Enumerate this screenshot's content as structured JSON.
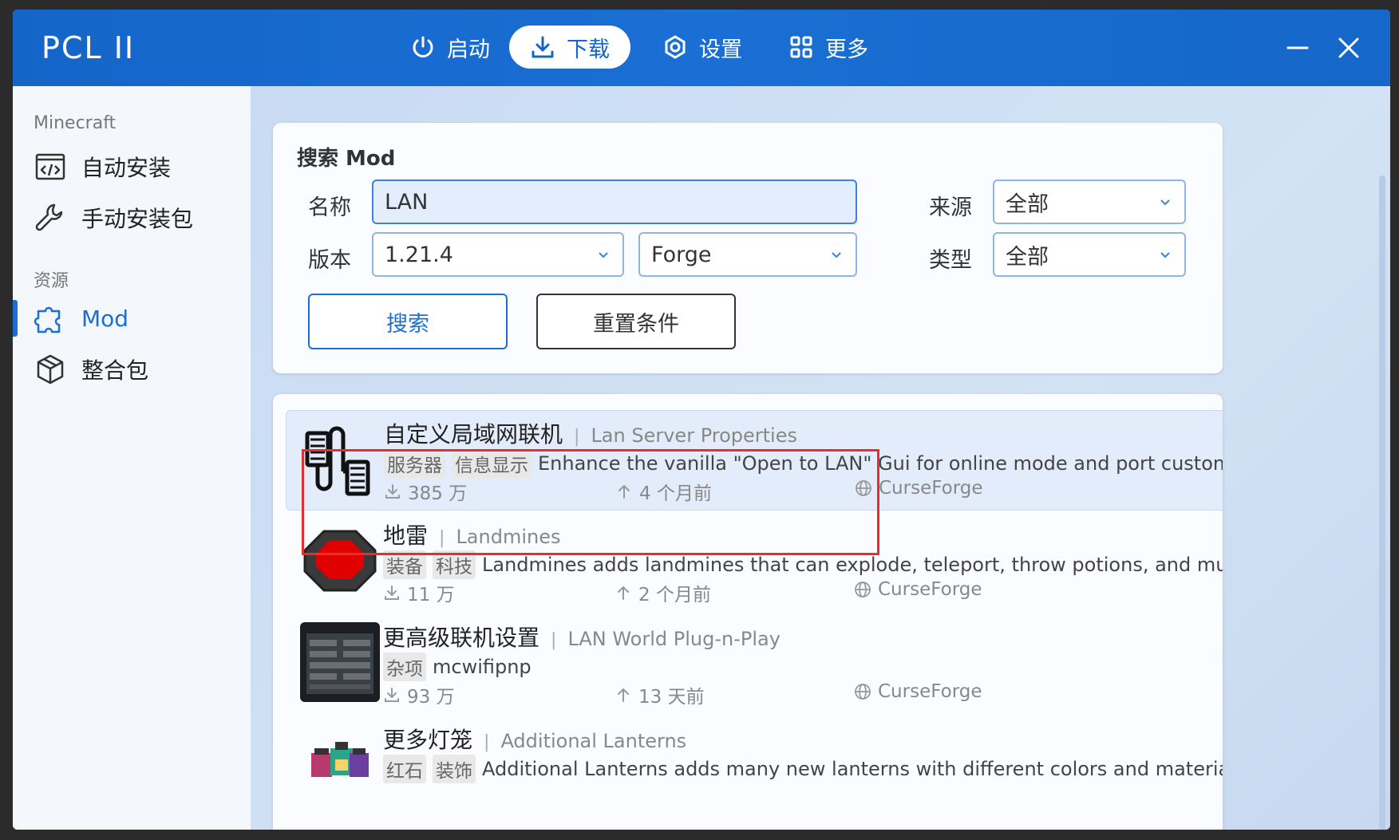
{
  "app": {
    "title": "PCL II"
  },
  "nav": [
    {
      "label": "启动",
      "icon": "power-icon"
    },
    {
      "label": "下载",
      "icon": "download-icon",
      "active": true
    },
    {
      "label": "设置",
      "icon": "settings-icon"
    },
    {
      "label": "更多",
      "icon": "grid-icon"
    }
  ],
  "window_controls": {
    "minimize": "minimize-icon",
    "close": "close-icon"
  },
  "sidebar": {
    "groups": [
      {
        "label": "Minecraft",
        "items": [
          {
            "label": "自动安装",
            "icon": "code-file-icon"
          },
          {
            "label": "手动安装包",
            "icon": "wrench-icon"
          }
        ]
      },
      {
        "label": "资源",
        "items": [
          {
            "label": "Mod",
            "icon": "puzzle-icon",
            "active": true
          },
          {
            "label": "整合包",
            "icon": "box-icon"
          }
        ]
      }
    ]
  },
  "search": {
    "title": "搜索 Mod",
    "name_label": "名称",
    "name_value": "LAN",
    "version_label": "版本",
    "version_value": "1.21.4",
    "loader_value": "Forge",
    "source_label": "来源",
    "source_value": "全部",
    "type_label": "类型",
    "type_value": "全部",
    "search_button": "搜索",
    "reset_button": "重置条件"
  },
  "results": [
    {
      "title": "自定义局域网联机",
      "subtitle": "Lan Server Properties",
      "tags": [
        "服务器",
        "信息显示"
      ],
      "description": "Enhance the vanilla \"Open to LAN\" Gui for online mode and port customization",
      "downloads": "385 万",
      "updated": "4 个月前",
      "source": "CurseForge",
      "highlighted": true
    },
    {
      "title": "地雷",
      "subtitle": "Landmines",
      "tags": [
        "装备",
        "科技"
      ],
      "description": "Landmines adds landmines that can explode, teleport, throw potions, and much more!",
      "downloads": "11 万",
      "updated": "2 个月前",
      "source": "CurseForge"
    },
    {
      "title": "更高级联机设置",
      "subtitle": "LAN World Plug-n-Play",
      "tags": [
        "杂项"
      ],
      "description": "mcwifipnp",
      "downloads": "93 万",
      "updated": "13 天前",
      "source": "CurseForge"
    },
    {
      "title": "更多灯笼",
      "subtitle": "Additional Lanterns",
      "tags": [
        "红石",
        "装饰"
      ],
      "description": "Additional Lanterns adds many new lanterns with different colors and materials!",
      "downloads": "",
      "updated": "",
      "source": ""
    }
  ],
  "colors": {
    "accent": "#1a6fd4",
    "titlebar": "#1565c9",
    "highlight_box": "#e03030"
  }
}
